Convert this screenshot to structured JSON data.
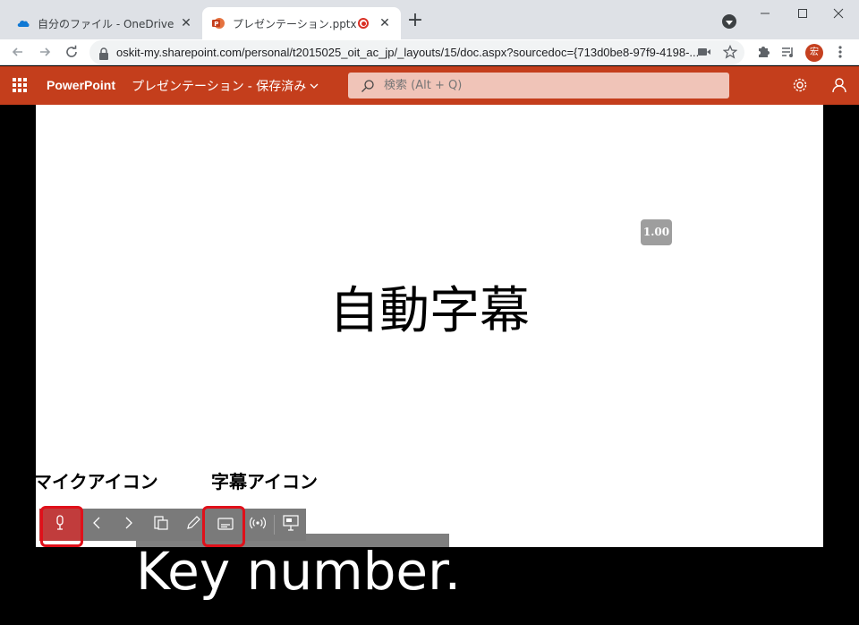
{
  "browser": {
    "tabs": [
      {
        "title": "自分のファイル - OneDrive",
        "favicon": "onedrive-icon"
      },
      {
        "title": "プレゼンテーション.pptx",
        "favicon": "powerpoint-icon",
        "recording": true
      }
    ],
    "url": "oskit-my.sharepoint.com/personal/t2015025_oit_ac_jp/_layouts/15/doc.aspx?sourcedoc={713d0be8-97f9-4198-...",
    "profile_initial": "宏"
  },
  "app": {
    "name": "PowerPoint",
    "doc_title": "プレゼンテーション",
    "save_status": "- 保存済み",
    "search_placeholder": "検索 (Alt + Q)",
    "accent": "#c43e1c"
  },
  "slide": {
    "title": "自動字幕",
    "speed_badge": "1.00"
  },
  "annotations": {
    "mic_label": "マイクアイコン",
    "subtitle_label": "字幕アイコン",
    "highlight_color": "#e0101a"
  },
  "controls": [
    "mic-icon",
    "previous-icon",
    "next-icon",
    "slides-icon",
    "pen-icon",
    "subtitles-icon",
    "live-broadcast-icon",
    "presenter-view-icon"
  ],
  "caption": {
    "text": "Key number."
  }
}
